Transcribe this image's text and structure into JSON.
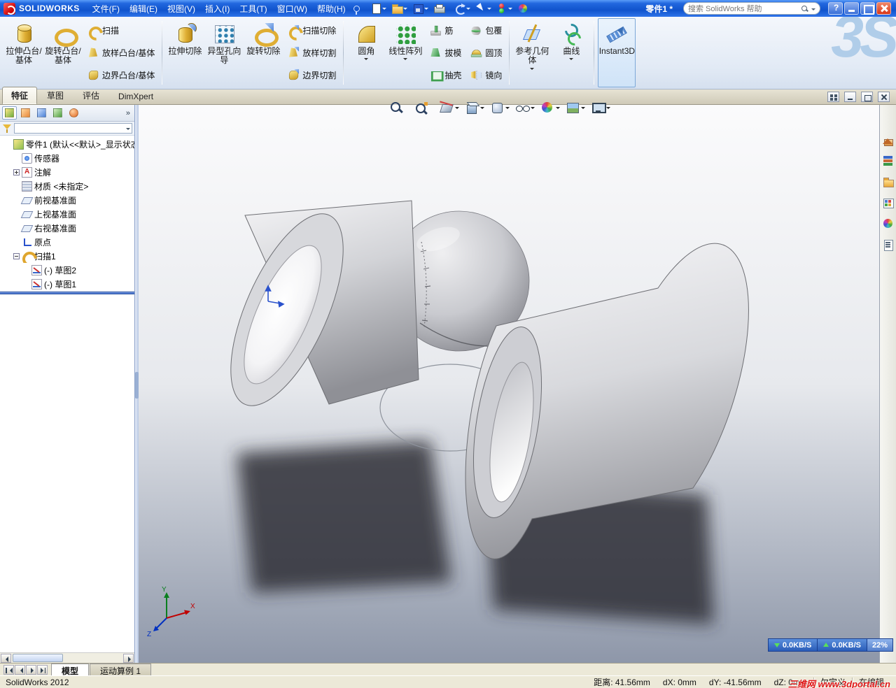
{
  "branding": {
    "app_name": "SOLIDWORKS",
    "ds_logo": "3S"
  },
  "titlebar": {
    "doc_title": "零件1 *",
    "search_placeholder": "搜索 SolidWorks 帮助",
    "menus": [
      {
        "label": "文件(F)"
      },
      {
        "label": "编辑(E)"
      },
      {
        "label": "视图(V)"
      },
      {
        "label": "插入(I)"
      },
      {
        "label": "工具(T)"
      },
      {
        "label": "窗口(W)"
      },
      {
        "label": "帮助(H)"
      }
    ],
    "qat": [
      {
        "cls": "qi-new",
        "caretcls": "on",
        "name": "new-document-icon"
      },
      {
        "cls": "qi-open",
        "caretcls": "on",
        "name": "open-icon"
      },
      {
        "cls": "qi-save",
        "caretcls": "on",
        "name": "save-icon"
      },
      {
        "cls": "qi-print",
        "caretcls": "off",
        "name": "print-icon"
      },
      {
        "cls": "qi-undo",
        "caretcls": "on",
        "name": "undo-icon"
      },
      {
        "cls": "qi-select",
        "caretcls": "on",
        "name": "select-icon"
      },
      {
        "cls": "qi-rebuild",
        "caretcls": "on",
        "name": "rebuild-icon"
      },
      {
        "cls": "qi-ball",
        "caretcls": "off",
        "name": "edit-appearance-icon"
      }
    ]
  },
  "ribbon": {
    "extrude_boss": "拉伸凸台/基体",
    "revolve_boss": "旋转凸台/基体",
    "sweep": "扫描",
    "loft_boss": "放样凸台/基体",
    "boundary_boss": "边界凸台/基体",
    "extrude_cut": "拉伸切除",
    "hole_wizard": "异型孔向导",
    "revolve_cut": "旋转切除",
    "sweep_cut": "扫描切除",
    "loft_cut": "放样切割",
    "boundary_cut": "边界切割",
    "fillet": "圆角",
    "linear_pattern": "线性阵列",
    "rib": "筋",
    "draft": "拔模",
    "shell": "抽壳",
    "wrap": "包覆",
    "dome": "圆顶",
    "mirror": "镜向",
    "ref_geometry": "参考几何体",
    "curves": "曲线",
    "instant3d": "Instant3D",
    "tabs": [
      {
        "label": "特征",
        "cls": "active"
      },
      {
        "label": "草图",
        "cls": ""
      },
      {
        "label": "评估",
        "cls": ""
      },
      {
        "label": "DimXpert",
        "cls": ""
      }
    ]
  },
  "doc_controls": [
    {
      "cls": "dc-grid",
      "name": "window-layout-icon"
    },
    {
      "cls": "dc-min",
      "name": "minimize-document-icon"
    },
    {
      "cls": "dc-restore",
      "name": "restore-document-icon"
    },
    {
      "cls": "dc-close",
      "name": "close-document-icon"
    }
  ],
  "panel": {
    "tabs": [
      {
        "cls": "pt-feature active",
        "name": "featuremanager-tab-icon"
      },
      {
        "cls": "pt-property",
        "name": "propertymanager-tab-icon"
      },
      {
        "cls": "pt-config",
        "name": "configurationmanager-tab-icon"
      },
      {
        "cls": "pt-dimx",
        "name": "dimxpertmanager-tab-icon"
      },
      {
        "cls": "pt-display",
        "name": "displaymanager-tab-icon"
      }
    ],
    "overflow": "»"
  },
  "feature_tree": {
    "items": [
      {
        "label": "零件1 (默认<<默认>_显示状态...",
        "icon": "ti-part",
        "expcls": "none",
        "indcls": "ind0",
        "name": "tree-item-part-root"
      },
      {
        "label": "传感器",
        "icon": "ti-sensors",
        "expcls": "none",
        "indcls": "ind1",
        "name": "tree-item-sensors"
      },
      {
        "label": "注解",
        "icon": "ti-annot",
        "expcls": "plus",
        "indcls": "ind1",
        "name": "tree-item-annotations"
      },
      {
        "label": "材质 <未指定>",
        "icon": "ti-material",
        "expcls": "none",
        "indcls": "ind1",
        "name": "tree-item-material"
      },
      {
        "label": "前视基准面",
        "icon": "ti-plane",
        "expcls": "none",
        "indcls": "ind1",
        "name": "tree-item-front-plane"
      },
      {
        "label": "上视基准面",
        "icon": "ti-plane",
        "expcls": "none",
        "indcls": "ind1",
        "name": "tree-item-top-plane"
      },
      {
        "label": "右视基准面",
        "icon": "ti-plane",
        "expcls": "none",
        "indcls": "ind1",
        "name": "tree-item-right-plane"
      },
      {
        "label": "原点",
        "icon": "ti-origin",
        "expcls": "none",
        "indcls": "ind1",
        "name": "tree-item-origin"
      },
      {
        "label": "扫描1",
        "icon": "ti-sweepC",
        "expcls": "minus",
        "indcls": "ind1",
        "name": "tree-item-sweep1"
      },
      {
        "label": "(-) 草图2",
        "icon": "ti-sketch",
        "expcls": "none",
        "indcls": "ind2",
        "name": "tree-item-sketch2"
      },
      {
        "label": "(-) 草图1",
        "icon": "ti-sketch",
        "expcls": "none",
        "indcls": "ind2",
        "name": "tree-item-sketch1"
      }
    ]
  },
  "hud": [
    {
      "cls": "hi-zoomfit",
      "caretcls": "off",
      "name": "zoom-fit-icon"
    },
    {
      "cls": "hi-zoomarea",
      "caretcls": "off",
      "name": "zoom-to-area-icon"
    },
    {
      "cls": "hi-section",
      "caretcls": "on",
      "name": "section-view-icon"
    },
    {
      "cls": "hi-vieworient",
      "caretcls": "on",
      "name": "view-orientation-icon"
    },
    {
      "cls": "hi-dispstyle",
      "caretcls": "on",
      "name": "display-style-icon"
    },
    {
      "cls": "hi-hideshow",
      "caretcls": "on",
      "name": "hide-show-items-icon"
    },
    {
      "cls": "hi-appearance",
      "caretcls": "on",
      "name": "edit-appearance-icon"
    },
    {
      "cls": "hi-scene",
      "caretcls": "on",
      "name": "apply-scene-icon"
    },
    {
      "cls": "hi-viewset",
      "caretcls": "on",
      "name": "view-settings-icon"
    }
  ],
  "taskpane": [
    {
      "cls": "tp-home",
      "name": "solidworks-resources-icon"
    },
    {
      "cls": "tp-library",
      "name": "design-library-icon"
    },
    {
      "cls": "tp-folder",
      "name": "file-explorer-icon"
    },
    {
      "cls": "tp-palette",
      "name": "view-palette-icon"
    },
    {
      "cls": "tp-appear",
      "name": "appearances-scenes-icon"
    },
    {
      "cls": "tp-props",
      "name": "custom-properties-icon"
    }
  ],
  "viewport_triad": {
    "x": "X",
    "y": "Y",
    "z": "Z"
  },
  "netmon": {
    "down": "0.0KB/S",
    "up": "0.0KB/S",
    "pct": "22%"
  },
  "bottom_tabs": {
    "model": "模型",
    "motion": "运动算例 1"
  },
  "statusbar": {
    "app": "SolidWorks 2012",
    "distance": "距离: 41.56mm",
    "dx": "dX: 0mm",
    "dy": "dY: -41.56mm",
    "dz": "dZ: 0mm",
    "state": "欠定义",
    "editing": "在编辑",
    "watermark": "三维网 www.3dportal.cn"
  }
}
